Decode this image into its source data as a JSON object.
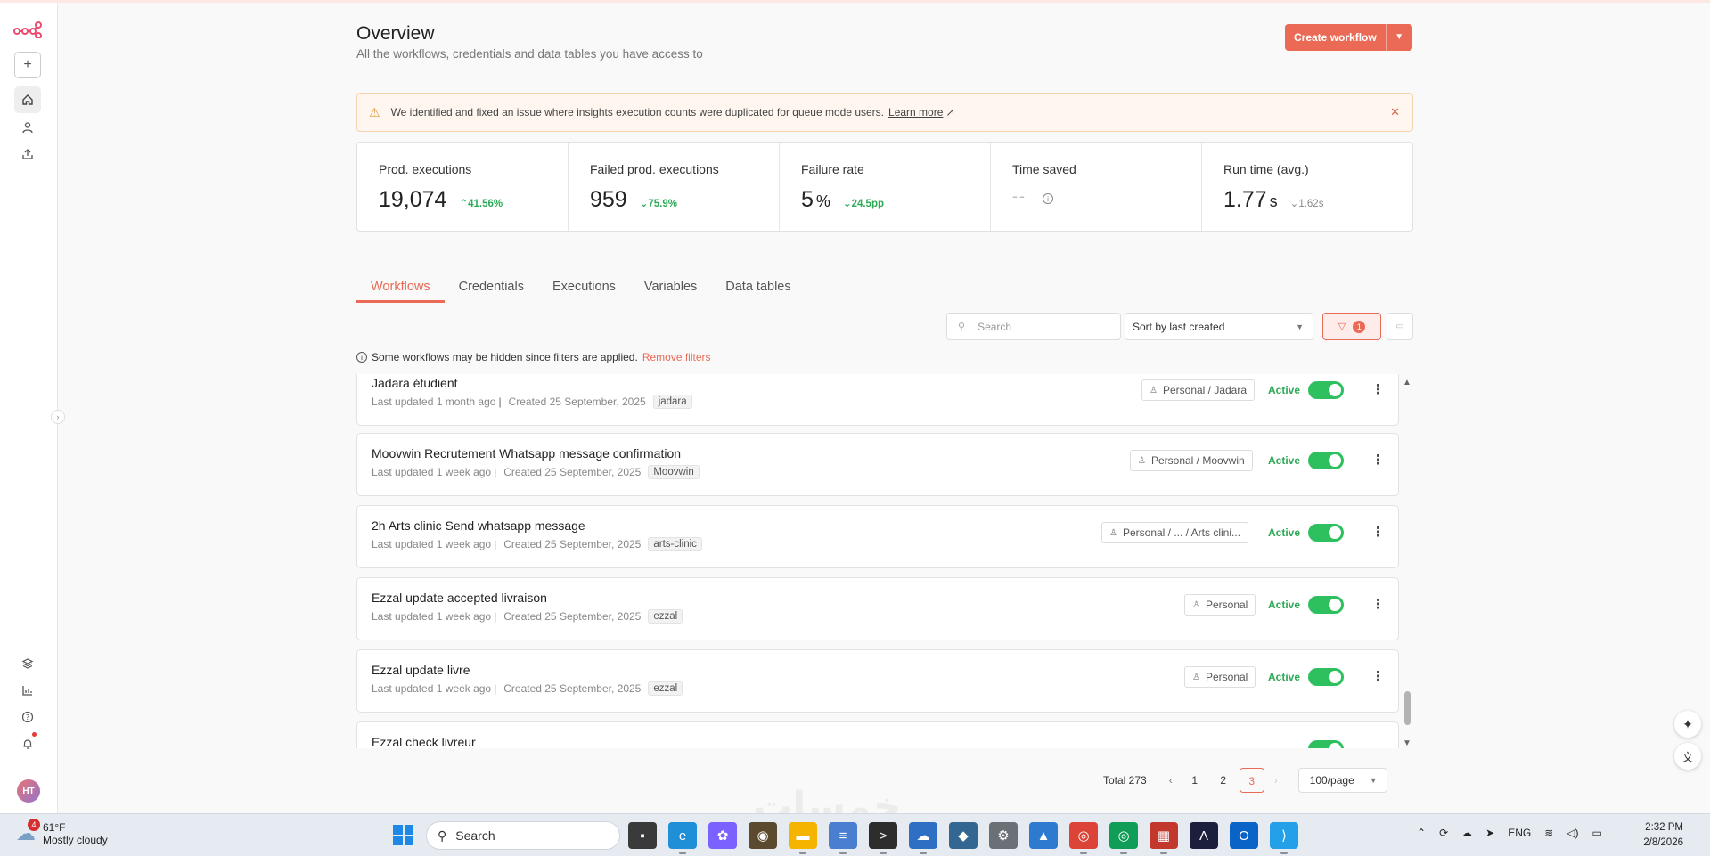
{
  "page": {
    "title": "Overview",
    "subtitle": "All the workflows, credentials and data tables you have access to",
    "create_button": "Create workflow"
  },
  "sidebar": {
    "avatar_initials": "HT",
    "icons": [
      "n8n-logo-icon",
      "plus-icon",
      "home-icon",
      "user-icon",
      "share-icon",
      "templates-icon",
      "insights-icon",
      "help-icon",
      "bell-icon"
    ]
  },
  "banner": {
    "text": "We identified and fixed an issue where insights execution counts were duplicated for queue mode users.",
    "link": "Learn more",
    "link_arrow": "↗"
  },
  "stats": [
    {
      "label": "Prod. executions",
      "value": "19,074",
      "unit": "",
      "change": "41.56%",
      "direction": "up",
      "color": "#2eaa57"
    },
    {
      "label": "Failed prod. executions",
      "value": "959",
      "unit": "",
      "change": "75.9%",
      "direction": "down",
      "color": "#2eaa57"
    },
    {
      "label": "Failure rate",
      "value": "5",
      "unit": "%",
      "change": "24.5pp",
      "direction": "down",
      "color": "#2eaa57"
    },
    {
      "label": "Time saved",
      "value": "--",
      "unit": "",
      "change": "",
      "direction": "none"
    },
    {
      "label": "Run time (avg.)",
      "value": "1.77",
      "unit": "s",
      "change": "1.62s",
      "direction": "down",
      "color": "#888888"
    }
  ],
  "tabs": [
    "Workflows",
    "Credentials",
    "Executions",
    "Variables",
    "Data tables"
  ],
  "controls": {
    "search_placeholder": "Search",
    "sort": "Sort by last created",
    "filter_count": "1"
  },
  "filter_notice": {
    "text": "Some workflows may be hidden since filters are applied.",
    "action": "Remove filters"
  },
  "workflows": [
    {
      "name": "Jadara étudient",
      "updated": "Last updated 1 month ago",
      "created": "Created 25 September, 2025",
      "tag": "jadara",
      "owner": "Personal / Jadara",
      "status": "Active"
    },
    {
      "name": "Moovwin Recrutement Whatsapp message confirmation",
      "updated": "Last updated 1 week ago",
      "created": "Created 25 September, 2025",
      "tag": "Moovwin",
      "owner": "Personal / Moovwin",
      "status": "Active"
    },
    {
      "name": "2h Arts clinic Send whatsapp message",
      "updated": "Last updated 1 week ago",
      "created": "Created 25 September, 2025",
      "tag": "arts-clinic",
      "owner": "Personal / ... / Arts clini...",
      "status": "Active"
    },
    {
      "name": "Ezzal update accepted livraison",
      "updated": "Last updated 1 week ago",
      "created": "Created 25 September, 2025",
      "tag": "ezzal",
      "owner": "Personal",
      "status": "Active"
    },
    {
      "name": "Ezzal update livre",
      "updated": "Last updated 1 week ago",
      "created": "Created 25 September, 2025",
      "tag": "ezzal",
      "owner": "Personal",
      "status": "Active"
    },
    {
      "name": "Ezzal check livreur",
      "updated": "",
      "created": "",
      "tag": "",
      "owner": "",
      "status": ""
    }
  ],
  "pagination": {
    "total": "Total 273",
    "pages": [
      "1",
      "2",
      "3"
    ],
    "current": "3",
    "page_size": "100/page"
  },
  "watermark": "خمسات",
  "taskbar": {
    "weather_temp": "61°F",
    "weather_desc": "Mostly cloudy",
    "weather_badge": "4",
    "search_label": "Search",
    "language": "ENG",
    "time": "2:32 PM",
    "date": "2/8/2026",
    "apps": [
      "file-explorer-icon",
      "edge-icon",
      "copilot-icon",
      "app-icon",
      "folder-icon",
      "notepad-icon",
      "terminal-icon",
      "onedrive-icon",
      "postgres-icon",
      "settings-icon",
      "photos-icon",
      "chrome-icon",
      "chrome-profile-icon",
      "task-manager-icon",
      "arc-icon",
      "outlook-icon",
      "vscode-icon"
    ]
  }
}
